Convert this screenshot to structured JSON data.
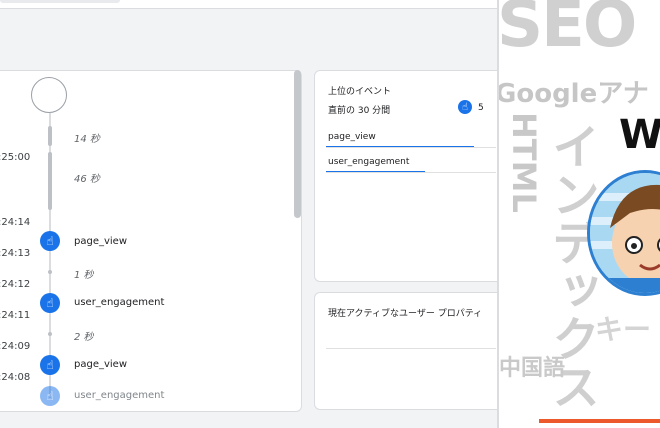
{
  "timeline": {
    "gaps": [
      "14 秒",
      "46 秒",
      "1 秒",
      "2 秒"
    ],
    "times": [
      ":25:00",
      ":24:14",
      ":24:13",
      ":24:12",
      ":24:11",
      ":24:09",
      ":24:08"
    ],
    "events": [
      "page_view",
      "user_engagement",
      "page_view",
      "user_engagement"
    ]
  },
  "events_card": {
    "title": "上位のイベント",
    "subtitle": "直前の 30 分間",
    "user_count": "5",
    "items": [
      "page_view",
      "user_engagement"
    ]
  },
  "active_card": {
    "title": "現在アクティブなユーザー プロパティ"
  },
  "overlay": {
    "seo": "SEO",
    "google": "Googleアナ",
    "html": "HTML",
    "index": "インデックス",
    "keyword": "キー",
    "chinese": "中国語",
    "w": "W"
  },
  "colors": {
    "accent": "#1a73e8",
    "orange": "#ec5a2c"
  }
}
